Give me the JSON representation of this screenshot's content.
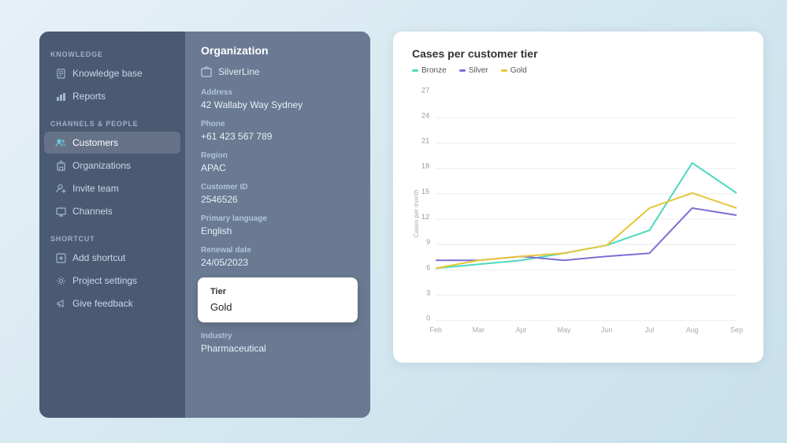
{
  "sidebar": {
    "sections": [
      {
        "label": "Knowledge",
        "items": [
          {
            "id": "knowledge-base",
            "label": "Knowledge base",
            "icon": "doc"
          },
          {
            "id": "reports",
            "label": "Reports",
            "icon": "chart"
          }
        ]
      },
      {
        "label": "Channels & People",
        "items": [
          {
            "id": "customers",
            "label": "Customers",
            "icon": "users",
            "active": true
          },
          {
            "id": "organizations",
            "label": "Organizations",
            "icon": "building"
          },
          {
            "id": "invite-team",
            "label": "Invite team",
            "icon": "person-add"
          },
          {
            "id": "channels",
            "label": "Channels",
            "icon": "monitor"
          }
        ]
      },
      {
        "label": "Shortcut",
        "items": [
          {
            "id": "add-shortcut",
            "label": "Add shortcut",
            "icon": "plus-square"
          },
          {
            "id": "project-settings",
            "label": "Project settings",
            "icon": "gear"
          },
          {
            "id": "give-feedback",
            "label": "Give feedback",
            "icon": "megaphone"
          }
        ]
      }
    ]
  },
  "detail": {
    "section_title": "Organization",
    "org_name": "SilverLine",
    "fields": [
      {
        "label": "Address",
        "value": "42 Wallaby Way Sydney"
      },
      {
        "label": "Phone",
        "value": "+61 423 567 789"
      },
      {
        "label": "Region",
        "value": "APAC"
      },
      {
        "label": "Customer ID",
        "value": "2546526"
      },
      {
        "label": "Primary language",
        "value": "English"
      },
      {
        "label": "Renewal date",
        "value": "24/05/2023"
      }
    ],
    "tier_popup": {
      "label": "Tier",
      "value": "Gold"
    },
    "industry_field": {
      "label": "Industry",
      "value": "Pharmaceutical"
    }
  },
  "chart": {
    "title": "Cases per customer tier",
    "legend": [
      {
        "label": "Bronze",
        "color": "#4dd9c0"
      },
      {
        "label": "Silver",
        "color": "#7b6fd4"
      },
      {
        "label": "Gold",
        "color": "#e8c53a"
      }
    ],
    "y_axis_title": "Cases per month",
    "x_labels": [
      "Feb",
      "Mar",
      "Apr",
      "May",
      "Jun",
      "Jul",
      "Aug",
      "Sep"
    ],
    "y_labels": [
      "0",
      "3",
      "6",
      "9",
      "12",
      "15",
      "18",
      "21",
      "24",
      "27"
    ],
    "series": {
      "bronze": [
        7,
        7.5,
        8,
        9,
        10,
        12,
        21,
        17
      ],
      "silver": [
        8,
        8,
        8.5,
        8,
        8.5,
        9,
        15,
        14
      ],
      "gold": [
        7,
        8,
        8.5,
        9,
        10,
        15,
        17,
        15
      ]
    }
  }
}
